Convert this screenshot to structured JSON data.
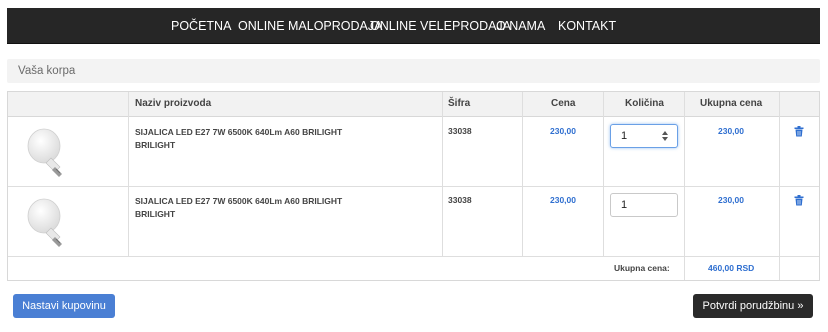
{
  "nav": {
    "items": [
      "POČETNA",
      "ONLINE MALOPRODAJA",
      "ONLINE VELEPRODAJA",
      "O NAMA",
      "KONTAKT"
    ]
  },
  "breadcrumb": {
    "label": "Vaša korpa"
  },
  "cart": {
    "headers": {
      "name": "Naziv proizvoda",
      "code": "Šifra",
      "price": "Cena",
      "qty": "Količina",
      "total": "Ukupna cena"
    },
    "rows": [
      {
        "name_line1": "SIJALICA LED E27 7W 6500K 640Lm A60 BRILIGHT",
        "name_line2": "BRILIGHT",
        "code": "33038",
        "price": "230,00",
        "qty": "1",
        "total": "230,00"
      },
      {
        "name_line1": "SIJALICA LED E27 7W 6500K 640Lm A60 BRILIGHT",
        "name_line2": "BRILIGHT",
        "code": "33038",
        "price": "230,00",
        "qty": "1",
        "total": "230,00"
      }
    ],
    "total_label": "Ukupna cena:",
    "total_value": "460,00 RSD"
  },
  "buttons": {
    "continue": "Nastavi kupovinu",
    "confirm": "Potvrdi porudžbinu »"
  },
  "icons": {
    "product": "led-bulb-icon",
    "delete": "trash-icon",
    "spinner": "spinner-arrows-icon"
  },
  "colors": {
    "nav_bg": "#262626",
    "price": "#2f6fd0",
    "primary_button": "#4a7fd4",
    "dark_button": "#2a2a2a"
  }
}
